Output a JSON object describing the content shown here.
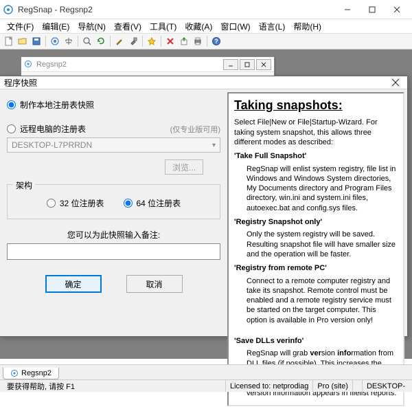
{
  "window": {
    "title": "RegSnap - Regsnp2"
  },
  "menu": {
    "file": "文件(F)",
    "edit": "编辑(E)",
    "nav": "导航(N)",
    "view": "查看(V)",
    "tools": "工具(T)",
    "fav": "收藏(A)",
    "window": "窗口(W)",
    "lang": "语言(L)",
    "help": "帮助(H)"
  },
  "mdi": {
    "title": "Regsnp2"
  },
  "dialog": {
    "title": "程序快照",
    "opt_local": "制作本地注册表快照",
    "opt_remote": "远程电脑的注册表",
    "remote_hint": "(仅专业版可用)",
    "combo_value": "DESKTOP-L7PRRDN",
    "browse": "浏览...",
    "group_legend": "架构",
    "opt_32bit": "32 位注册表",
    "opt_64bit": "64 位注册表",
    "note_label": "您可以为此快照输入备注:",
    "note_value": "",
    "ok": "确定",
    "cancel": "取消"
  },
  "help": {
    "heading": "Taking snapshots:",
    "intro": "Select File|New or File|Startup-Wizard. For taking system snapshot, this allows three different modes as described:",
    "m1_title": "'Take Full Snapshot'",
    "m1_desc": "RegSnap will enlist system registry, file list in Windows and Windows System directories, My Documents directory and Program Files directory, win.ini and system.ini files, autoexec.bat and config.sys files.",
    "m2_title": "'Registry Snapshot only'",
    "m2_desc": "Only the system registry will be saved. Resulting snapshot file will have smaller size and the operation will be faster.",
    "m3_title": "'Registry from remote PC'",
    "m3_desc": "Connect to a remote computer registry and take its snapshot. Remote control must be enabled and a remote registry service must be started on the target computer. This option is available in Pro version only!",
    "m4_title": "'Save DLLs verinfo'",
    "m4_desc_pre": "RegSnap will grab ",
    "m4_desc_b1": "ver",
    "m4_desc_mid1": "sion ",
    "m4_desc_b2": "info",
    "m4_desc_post": "rmation from DLL files (if possible). This increases the time taken and the filesize of the snapshot slightly. But with an added advantage that version information appears in filelist reports."
  },
  "tabs": {
    "tab1": "Regsnp2"
  },
  "status": {
    "help": "要获得帮助, 请按 F1",
    "license": "Licensed to: netprodiag",
    "edition": "Pro (site)",
    "host": "DESKTOP-"
  }
}
